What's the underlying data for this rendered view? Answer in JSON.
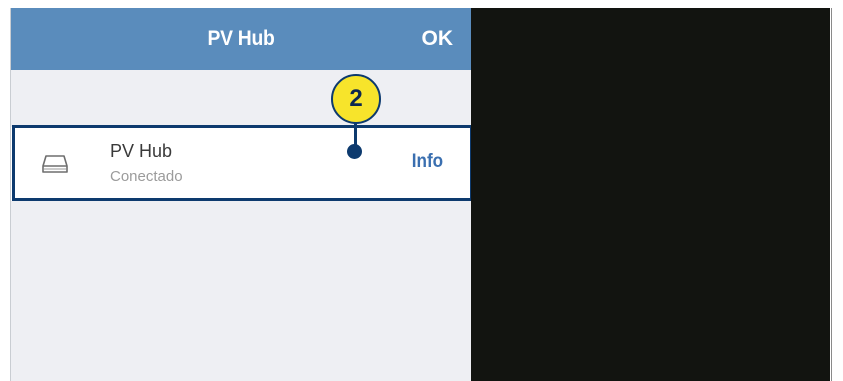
{
  "header": {
    "title": "PV Hub",
    "ok_label": "OK"
  },
  "device": {
    "name": "PV Hub",
    "status": "Conectado",
    "info_label": "Info",
    "icon": "drive-icon"
  },
  "callout": {
    "number": "2"
  },
  "colors": {
    "header_bg": "#5a8cbc",
    "list_bg": "#eeeff3",
    "highlight_border": "#0d3a6e",
    "callout_bg": "#f7e42b",
    "link": "#3a6fb0",
    "dark_panel": "#121410"
  }
}
